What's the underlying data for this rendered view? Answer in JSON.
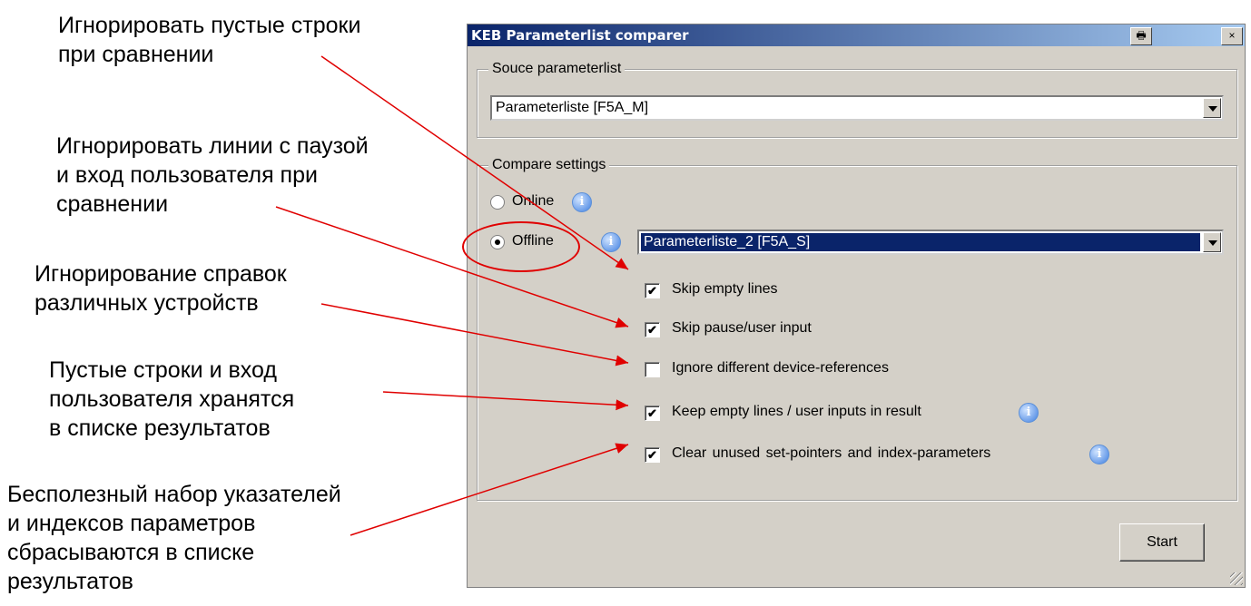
{
  "annotations": {
    "n1": "Игнорировать пустые строки\nпри сравнении",
    "n2": "Игнорировать линии с паузой\nи вход пользователя при\nсравнении",
    "n3": "Игнорирование справок\nразличных устройств",
    "n4": "Пустые строки и вход\nпользователя хранятся\nв списке результатов",
    "n5": "Бесполезный набор указателей\nи индексов параметров\nсбрасываются в списке\nрезультатов"
  },
  "window": {
    "title": "KEB Parameterlist comparer",
    "print_glyph": "🖶",
    "close_glyph": "×"
  },
  "source": {
    "group_label": "Souce parameterlist",
    "value": "Parameterliste [F5A_M]"
  },
  "compare": {
    "group_label": "Compare settings",
    "online_label": "Online",
    "offline_label": "Offline",
    "offline_value": "Parameterliste_2 [F5A_S]",
    "info_glyph": "i",
    "checkboxes": [
      {
        "label": "Skip empty lines",
        "checked": true
      },
      {
        "label": "Skip pause/user input",
        "checked": true
      },
      {
        "label": "Ignore different device-references",
        "checked": false
      },
      {
        "label": "Keep empty lines / user inputs in result",
        "checked": true
      },
      {
        "label": "Clear unused  set-pointers  and  index-parameters",
        "checked": true
      }
    ],
    "check_glyph": "✔"
  },
  "start_label": "Start",
  "colors": {
    "arrow": "#e00000",
    "title_start": "#0a246a",
    "title_end": "#a6caf0",
    "face": "#d4d0c8"
  }
}
